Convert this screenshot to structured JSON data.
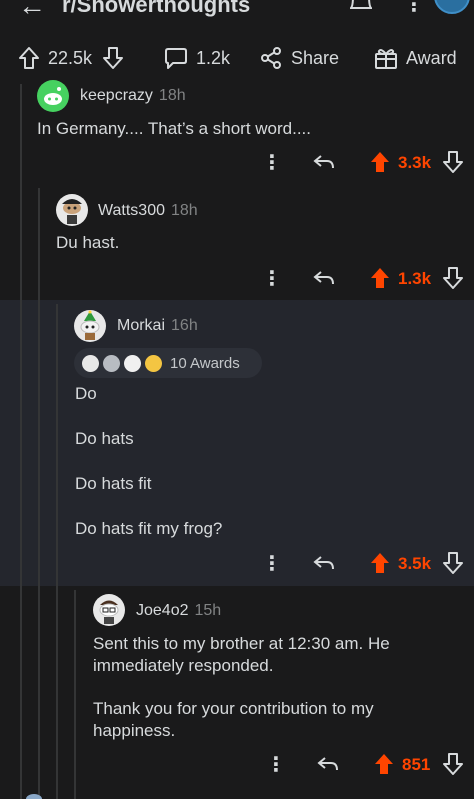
{
  "header": {
    "subreddit": "r/Showerthoughts",
    "back_icon": "back-arrow-icon",
    "bell_icon": "bell-icon",
    "more_icon": "more-vertical-icon"
  },
  "post_actions": {
    "upvotes": "22.5k",
    "comments": "1.2k",
    "share_label": "Share",
    "award_label": "Award"
  },
  "colors": {
    "upvote_orange": "#ff4500",
    "background": "#1a1a1b",
    "highlight_bg": "#24262d"
  },
  "comments": [
    {
      "username": "keepcrazy",
      "age": "18h",
      "lines": [
        "In Germany.... That’s a short word...."
      ],
      "score": "3.3k"
    },
    {
      "username": "Watts300",
      "age": "18h",
      "lines": [
        "Du hast."
      ],
      "score": "1.3k"
    },
    {
      "username": "Morkai",
      "age": "16h",
      "awards_label": "10 Awards",
      "lines": [
        "Do",
        "Do hats",
        "Do hats fit",
        "Do hats fit my frog?"
      ],
      "score": "3.5k"
    },
    {
      "username": "Joe4o2",
      "age": "15h",
      "lines": [
        "Sent this to my brother at 12:30 am. He immediately responded.",
        "Thank you for your contribution to my happiness."
      ],
      "score": "851"
    }
  ]
}
